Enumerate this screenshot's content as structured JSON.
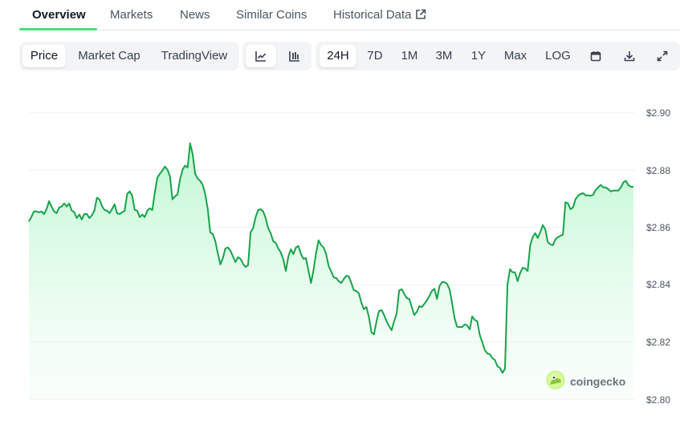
{
  "tabs": {
    "overview": "Overview",
    "markets": "Markets",
    "news": "News",
    "similar_coins": "Similar Coins",
    "historical_data": "Historical Data"
  },
  "chart_type_buttons": {
    "price": "Price",
    "market_cap": "Market Cap",
    "tradingview": "TradingView",
    "selected": "Price"
  },
  "view_toggles": {
    "line_icon": "line-chart-icon",
    "candle_icon": "candlestick-icon",
    "selected": "line"
  },
  "range_buttons": {
    "h24": "24H",
    "d7": "7D",
    "m1": "1M",
    "m3": "3M",
    "y1": "1Y",
    "max": "Max",
    "log": "LOG",
    "selected": "24H",
    "calendar_icon": "calendar-icon",
    "download_icon": "download-icon",
    "fullscreen_icon": "expand-icon"
  },
  "watermark": {
    "text": "coingecko",
    "icon": "gecko-logo-icon"
  },
  "colors": {
    "line": "#16a34a",
    "fill_top": "#bbf7d0",
    "grid": "#eef0f2",
    "accent_tab": "#4ade80"
  },
  "chart_data": {
    "type": "area",
    "title": "",
    "xlabel": "",
    "ylabel": "",
    "ylim": [
      2.8,
      2.9
    ],
    "yticks": [
      "$2.90",
      "$2.88",
      "$2.86",
      "$2.84",
      "$2.82",
      "$2.80"
    ],
    "grid": true,
    "series": [
      {
        "values": [
          2.8621,
          2.8637,
          2.8656,
          2.8656,
          2.8653,
          2.8656,
          2.8647,
          2.8664,
          2.8692,
          2.8673,
          2.8656,
          2.865,
          2.867,
          2.8673,
          2.8684,
          2.8673,
          2.8684,
          2.8659,
          2.8653,
          2.8633,
          2.8645,
          2.8628,
          2.8647,
          2.8647,
          2.8633,
          2.8642,
          2.8659,
          2.8704,
          2.8698,
          2.8675,
          2.8661,
          2.8659,
          2.865,
          2.8664,
          2.8681,
          2.865,
          2.8647,
          2.8653,
          2.8658,
          2.8717,
          2.8726,
          2.8712,
          2.8661,
          2.8659,
          2.8636,
          2.8645,
          2.8636,
          2.8659,
          2.8667,
          2.8661,
          2.8723,
          2.8774,
          2.8788,
          2.8799,
          2.8813,
          2.8802,
          2.8779,
          2.8698,
          2.8709,
          2.8715,
          2.8769,
          2.8802,
          2.8816,
          2.881,
          2.8894,
          2.8857,
          2.8788,
          2.8771,
          2.8763,
          2.8749,
          2.8717,
          2.8664,
          2.8583,
          2.8577,
          2.8552,
          2.851,
          2.8471,
          2.8493,
          2.8527,
          2.853,
          2.8519,
          2.8499,
          2.8479,
          2.8496,
          2.849,
          2.8473,
          2.8462,
          2.8468,
          2.8583,
          2.8597,
          2.8636,
          2.8661,
          2.8664,
          2.8656,
          2.8633,
          2.8597,
          2.858,
          2.8552,
          2.8546,
          2.8527,
          2.8513,
          2.8488,
          2.8448,
          2.8499,
          2.8524,
          2.8507,
          2.853,
          2.8535,
          2.8507,
          2.849,
          2.8493,
          2.8448,
          2.8406,
          2.8451,
          2.851,
          2.8555,
          2.8538,
          2.853,
          2.8507,
          2.8465,
          2.8446,
          2.8426,
          2.8423,
          2.8412,
          2.8406,
          2.842,
          2.8431,
          2.8429,
          2.8406,
          2.8381,
          2.8378,
          2.837,
          2.8336,
          2.8314,
          2.8322,
          2.8286,
          2.8233,
          2.8227,
          2.8272,
          2.8308,
          2.8311,
          2.8294,
          2.8272,
          2.8255,
          2.8241,
          2.8272,
          2.83,
          2.838,
          2.8384,
          2.8368,
          2.8353,
          2.835,
          2.8322,
          2.8294,
          2.8305,
          2.8325,
          2.8322,
          2.8333,
          2.8345,
          2.8361,
          2.8378,
          2.8386,
          2.835,
          2.8395,
          2.8409,
          2.8409,
          2.8403,
          2.8384,
          2.8336,
          2.8283,
          2.8253,
          2.8252,
          2.8252,
          2.8261,
          2.8258,
          2.8244,
          2.8289,
          2.8277,
          2.8272,
          2.8224,
          2.8199,
          2.8171,
          2.816,
          2.8157,
          2.8143,
          2.8137,
          2.8115,
          2.8109,
          2.8092,
          2.8106,
          2.8401,
          2.8454,
          2.8443,
          2.8443,
          2.8412,
          2.844,
          2.8459,
          2.8457,
          2.8448,
          2.8538,
          2.8566,
          2.858,
          2.8563,
          2.8583,
          2.8608,
          2.8594,
          2.8549,
          2.8541,
          2.8538,
          2.8558,
          2.8566,
          2.8571,
          2.8575,
          2.8688,
          2.8684,
          2.8664,
          2.867,
          2.8698,
          2.8711,
          2.8717,
          2.872,
          2.8712,
          2.8712,
          2.8711,
          2.8714,
          2.8731,
          2.874,
          2.8749,
          2.874,
          2.874,
          2.8734,
          2.8726,
          2.8729,
          2.8729,
          2.8729,
          2.874,
          2.8758,
          2.8763,
          2.8748,
          2.8742,
          2.8742
        ]
      }
    ]
  }
}
